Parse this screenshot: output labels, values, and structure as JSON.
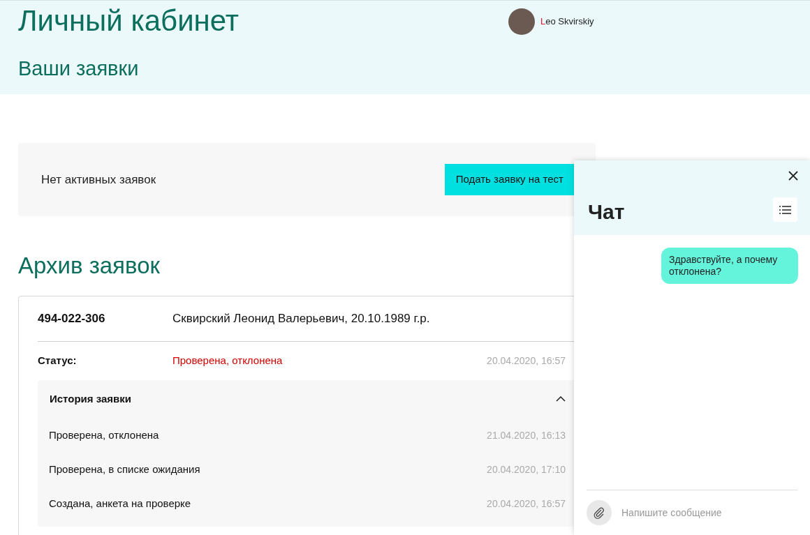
{
  "header": {
    "title": "Личный кабинет",
    "subtitle": "Ваши заявки",
    "user": {
      "name": "Leo Skvirskiy"
    }
  },
  "active": {
    "message": "Нет активных заявок",
    "button": "Подать заявку на тест"
  },
  "archive": {
    "title": "Архив заявок",
    "application": {
      "number": "494-022-306",
      "person": "Сквирский Леонид Валерьевич, 20.10.1989 г.р.",
      "status_label": "Статус:",
      "status": "Проверена, отклонена",
      "status_date": "20.04.2020, 16:57",
      "history": {
        "title": "История заявки",
        "expanded": true,
        "items": [
          {
            "text": "Проверена, отклонена",
            "date": "21.04.2020, 16:13"
          },
          {
            "text": "Проверена, в списке ожидания",
            "date": "20.04.2020, 17:10"
          },
          {
            "text": "Создана, анкета на проверке",
            "date": "20.04.2020, 16:57"
          }
        ]
      }
    }
  },
  "chat": {
    "title": "Чат",
    "messages": [
      {
        "text": "Здравствуйте, а почему отклонена?"
      }
    ],
    "input": {
      "placeholder": "Напишите сообщение"
    }
  }
}
